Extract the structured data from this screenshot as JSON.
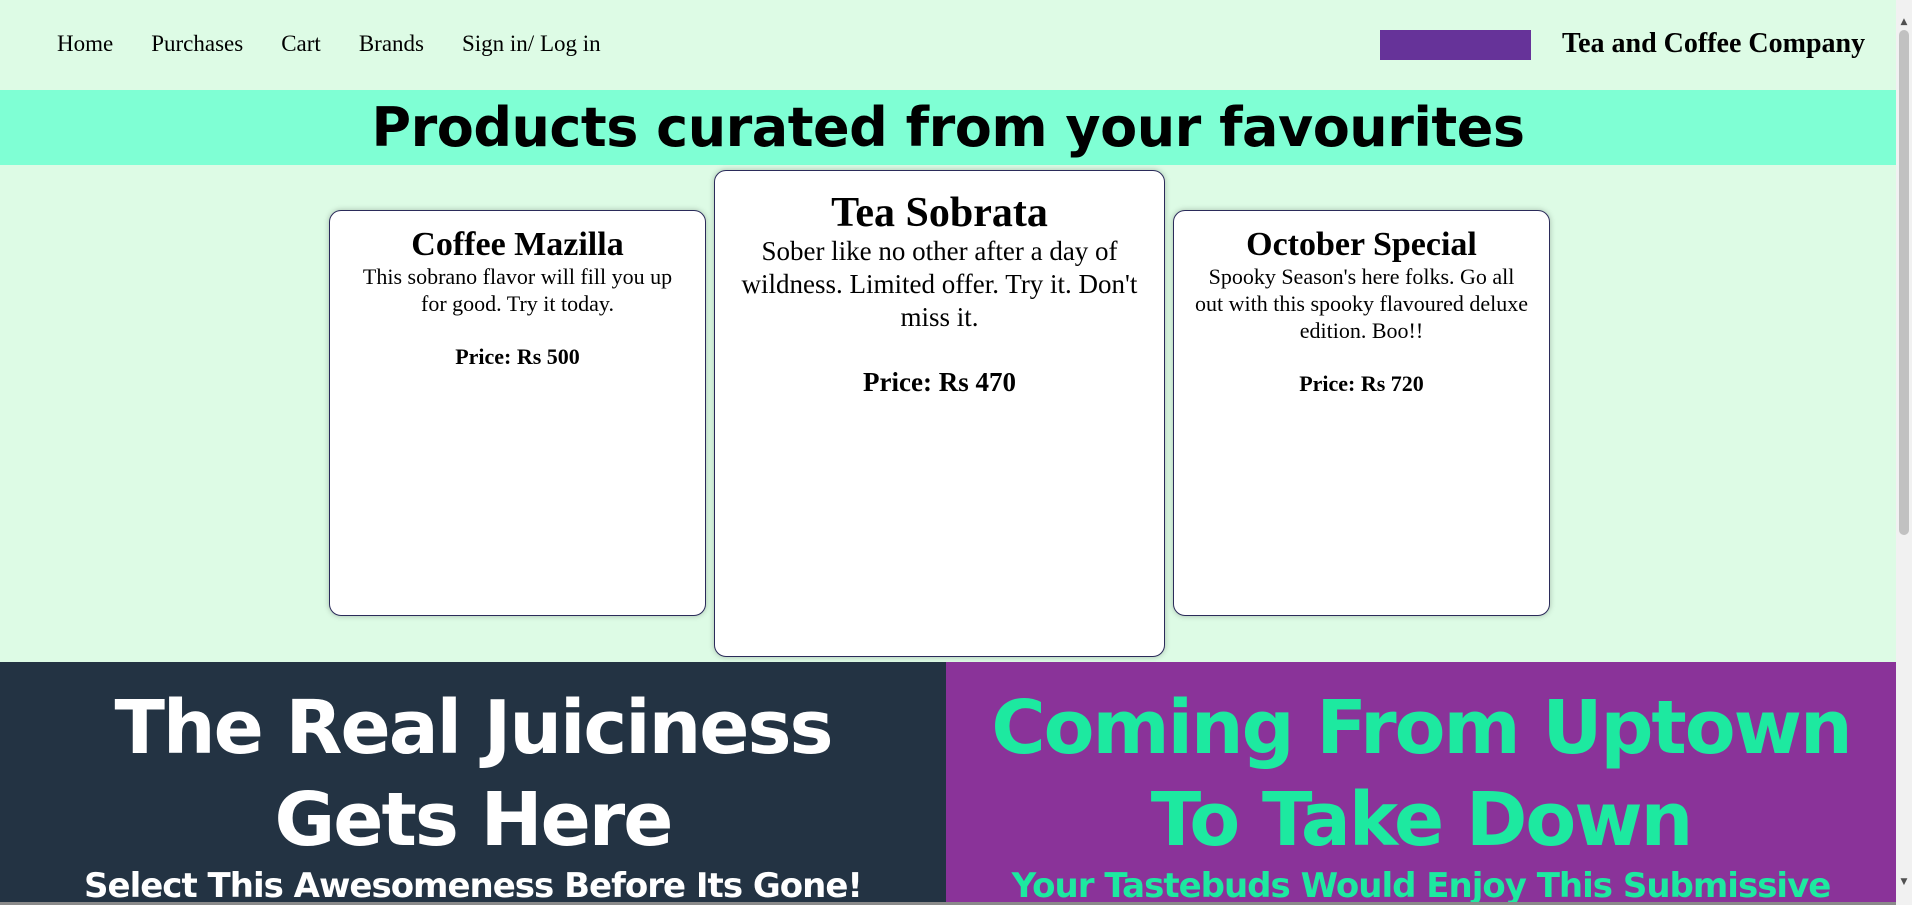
{
  "nav": {
    "links": [
      "Home",
      "Purchases",
      "Cart",
      "Brands",
      "Sign in/ Log in"
    ],
    "swatch_color": "#663399",
    "brand": "Tea and Coffee Company"
  },
  "hero": {
    "title": "Products curated from your favourites",
    "background": "#7fffd4"
  },
  "cards": [
    {
      "title": "Coffee Mazilla",
      "description": "This sobrano flavor will fill you up for good. Try it today.",
      "price": "Price: Rs 500"
    },
    {
      "title": "Tea Sobrata",
      "description": "Sober like no other after a day of wildness. Limited offer. Try it. Don't miss it.",
      "price": "Price: Rs 470"
    },
    {
      "title": "October Special",
      "description": "Spooky Season's here folks. Go all out with this spooky flavoured deluxe edition. Boo!!",
      "price": "Price: Rs 720"
    }
  ],
  "panels": {
    "left": {
      "heading": "The Real Juiciness Gets Here",
      "subheading": "Select This Awesomeness Before Its Gone!",
      "background": "#233343",
      "text_color": "#ffffff"
    },
    "right": {
      "heading": "Coming From Uptown To Take Down",
      "subheading": "Your Tastebuds Would Enjoy This Submissive",
      "background": "#8a3399",
      "text_color": "#1de9a0"
    }
  },
  "icons": {
    "scroll_up": "scroll-up-arrow-icon",
    "scroll_down": "scroll-down-arrow-icon"
  }
}
